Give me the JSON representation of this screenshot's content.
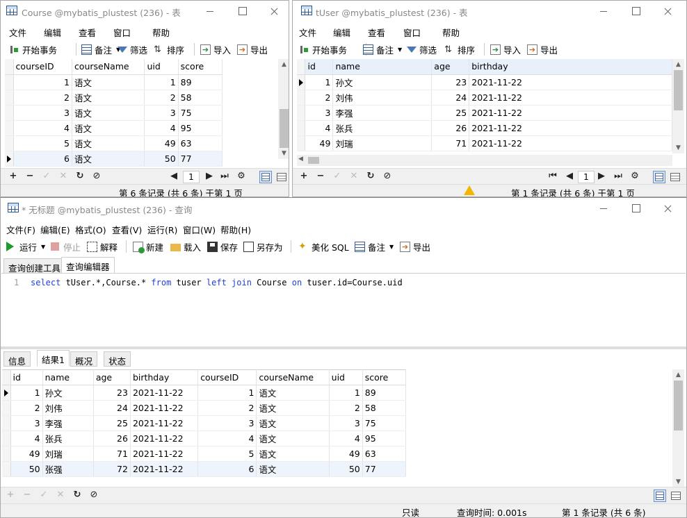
{
  "course_window": {
    "title": "Course @mybatis_plustest (236) - 表",
    "menu": [
      "文件",
      "编辑",
      "查看",
      "窗口",
      "帮助"
    ],
    "toolbar": {
      "begin_tx": "开始事务",
      "notes": "备注",
      "filter": "筛选",
      "sort": "排序",
      "import": "导入",
      "export": "导出"
    },
    "columns": [
      "courseID",
      "courseName",
      "uid",
      "score"
    ],
    "rows": [
      [
        "1",
        "语文",
        "1",
        "89"
      ],
      [
        "2",
        "语文",
        "2",
        "58"
      ],
      [
        "3",
        "语文",
        "3",
        "75"
      ],
      [
        "4",
        "语文",
        "4",
        "95"
      ],
      [
        "5",
        "语文",
        "49",
        "63"
      ],
      [
        "6",
        "语文",
        "50",
        "77"
      ]
    ],
    "page": "1",
    "status": "第 6 条记录 (共 6 条) 于第 1 页"
  },
  "tuser_window": {
    "title": "tUser @mybatis_plustest (236) - 表",
    "menu": [
      "文件",
      "编辑",
      "查看",
      "窗口",
      "帮助"
    ],
    "toolbar": {
      "begin_tx": "开始事务",
      "notes": "备注",
      "filter": "筛选",
      "sort": "排序",
      "import": "导入",
      "export": "导出"
    },
    "columns": [
      "id",
      "name",
      "age",
      "birthday"
    ],
    "rows": [
      [
        "1",
        "孙文",
        "23",
        "2021-11-22"
      ],
      [
        "2",
        "刘伟",
        "24",
        "2021-11-22"
      ],
      [
        "3",
        "李强",
        "25",
        "2021-11-22"
      ],
      [
        "4",
        "张兵",
        "26",
        "2021-11-22"
      ],
      [
        "49",
        "刘瑞",
        "71",
        "2021-11-22"
      ]
    ],
    "page": "1",
    "status": "第 1 条记录 (共 6 条) 于第 1 页"
  },
  "query_window": {
    "title": "* 无标题 @mybatis_plustest (236) - 查询",
    "menu": [
      "文件(F)",
      "编辑(E)",
      "格式(O)",
      "查看(V)",
      "运行(R)",
      "窗口(W)",
      "帮助(H)"
    ],
    "toolbar": {
      "run": "运行",
      "stop": "停止",
      "explain": "解释",
      "new": "新建",
      "load": "载入",
      "save": "保存",
      "save_as": "另存为",
      "beautify": "美化 SQL",
      "notes": "备注",
      "export": "导出"
    },
    "editor_tabs": [
      "查询创建工具",
      "查询编辑器"
    ],
    "sql": {
      "line_no": "1",
      "select": "select",
      "part1": " tUser.*,Course.* ",
      "from": "from",
      "part2": " tuser ",
      "left": "left",
      "join": "join",
      "part3": " Course ",
      "on": "on",
      "part4": " tuser.id=Course.uid"
    },
    "result_tabs": [
      "信息",
      "结果1",
      "概况",
      "状态"
    ],
    "columns": [
      "id",
      "name",
      "age",
      "birthday",
      "courseID",
      "courseName",
      "uid",
      "score"
    ],
    "rows": [
      [
        "1",
        "孙文",
        "23",
        "2021-11-22",
        "1",
        "语文",
        "1",
        "89"
      ],
      [
        "2",
        "刘伟",
        "24",
        "2021-11-22",
        "2",
        "语文",
        "2",
        "58"
      ],
      [
        "3",
        "李强",
        "25",
        "2021-11-22",
        "3",
        "语文",
        "3",
        "75"
      ],
      [
        "4",
        "张兵",
        "26",
        "2021-11-22",
        "4",
        "语文",
        "4",
        "95"
      ],
      [
        "49",
        "刘瑞",
        "71",
        "2021-11-22",
        "5",
        "语文",
        "49",
        "63"
      ],
      [
        "50",
        "张强",
        "72",
        "2021-11-22",
        "6",
        "语文",
        "50",
        "77"
      ]
    ],
    "status": {
      "readonly": "只读",
      "query_time": "查询时间: 0.001s",
      "record": "第 1 条记录 (共 6 条)"
    }
  }
}
